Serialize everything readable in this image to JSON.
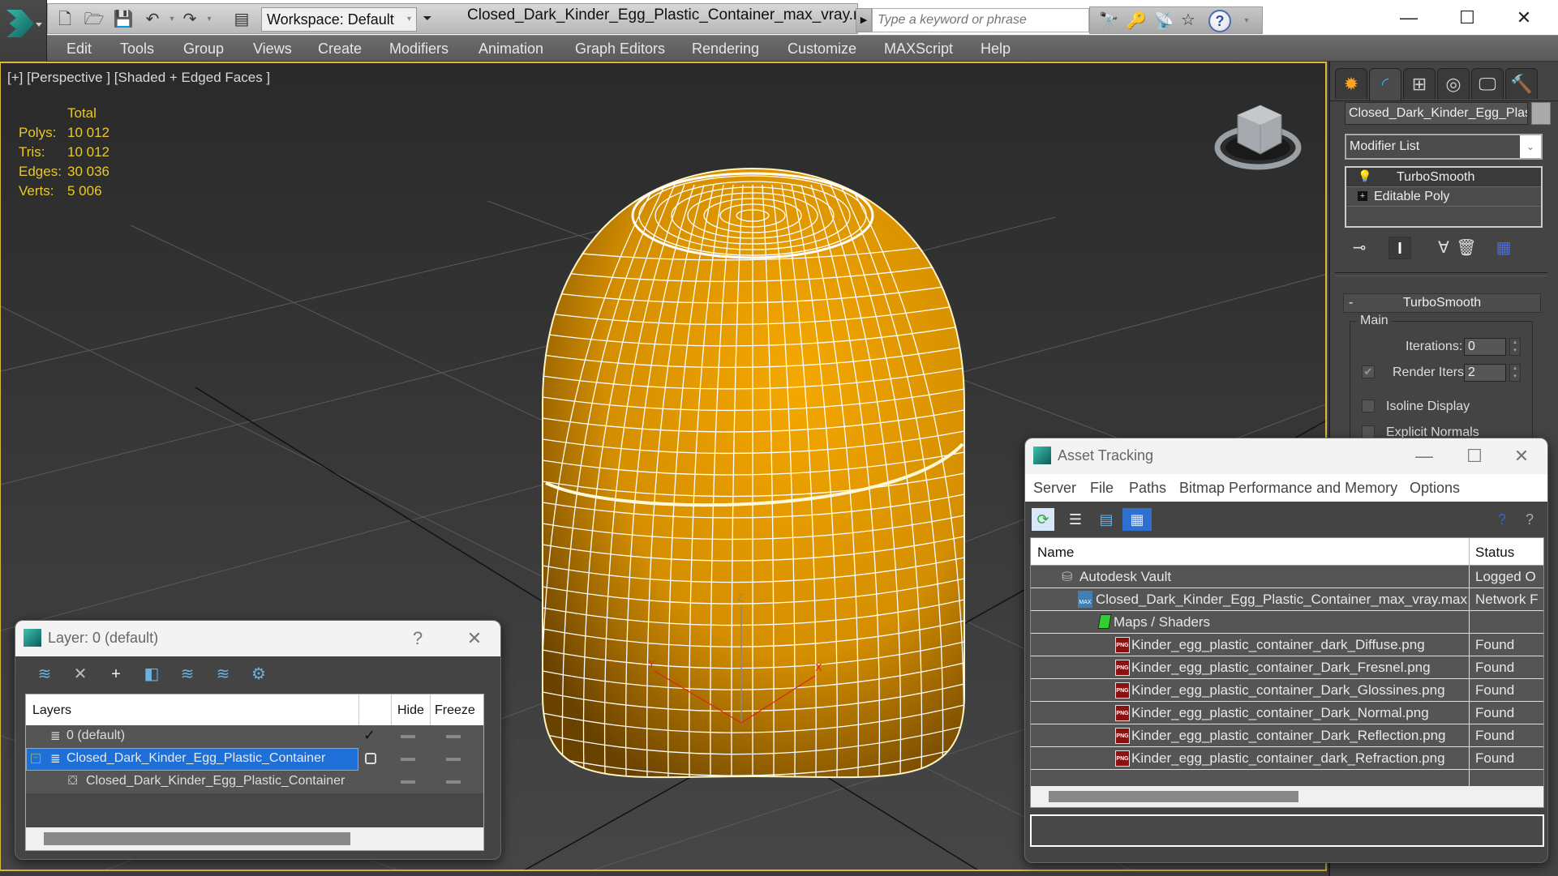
{
  "app": {
    "workspace_label": "Workspace: Default",
    "document_title": "Closed_Dark_Kinder_Egg_Plastic_Container_max_vray.max",
    "search_placeholder": "Type a keyword or phrase",
    "window_controls": {
      "minimize": "—",
      "maximize": "☐",
      "close": "✕"
    }
  },
  "menu": [
    "Edit",
    "Tools",
    "Group",
    "Views",
    "Create",
    "Modifiers",
    "Animation",
    "Graph Editors",
    "Rendering",
    "Customize",
    "MAXScript",
    "Help"
  ],
  "viewport": {
    "label": "[+] [Perspective ] [Shaded + Edged Faces ]",
    "stats": {
      "header": "Total",
      "rows": [
        {
          "label": "Polys:",
          "value": "10 012"
        },
        {
          "label": "Tris:",
          "value": "10 012"
        },
        {
          "label": "Edges:",
          "value": "30 036"
        },
        {
          "label": "Verts:",
          "value": "5 006"
        }
      ]
    },
    "model_color": "#f0a000",
    "wire_color": "#ffffff",
    "gizmo_axes": [
      "X",
      "Y",
      "Z"
    ]
  },
  "command_panel": {
    "tabs": [
      "create",
      "modify",
      "hierarchy",
      "motion",
      "display",
      "utilities"
    ],
    "active_tab": "modify",
    "object_name": "Closed_Dark_Kinder_Egg_Plastic_Container",
    "modifier_list_label": "Modifier List",
    "stack": [
      "TurboSmooth",
      "Editable Poly"
    ],
    "rollout_title": "TurboSmooth",
    "rollout_collapse": "-",
    "group_label": "Main",
    "iterations_label": "Iterations:",
    "iterations_value": "0",
    "render_iters_label": "Render Iters:",
    "render_iters_value": "2",
    "render_iters_checked": true,
    "isoline_label": "Isoline Display",
    "isoline_checked": false,
    "explicit_normals_label": "Explicit Normals",
    "explicit_normals_checked": false
  },
  "asset_tracking": {
    "title": "Asset Tracking",
    "menu": [
      "Server",
      "File",
      "Paths",
      "Bitmap Performance and Memory",
      "Options"
    ],
    "columns": [
      "Name",
      "Status"
    ],
    "rows": [
      {
        "name": "Autodesk Vault",
        "status": "Logged O",
        "level": 0,
        "icon": "vault-icon"
      },
      {
        "name": "Closed_Dark_Kinder_Egg_Plastic_Container_max_vray.max",
        "status": "Network F",
        "level": 1,
        "icon": "max-file-icon"
      },
      {
        "name": "Maps / Shaders",
        "status": "",
        "level": 2,
        "icon": "maps-icon"
      },
      {
        "name": "Kinder_egg_plastic_container_dark_Diffuse.png",
        "status": "Found",
        "level": 3,
        "icon": "png-icon"
      },
      {
        "name": "Kinder_egg_plastic_container_Dark_Fresnel.png",
        "status": "Found",
        "level": 3,
        "icon": "png-icon"
      },
      {
        "name": "Kinder_egg_plastic_container_Dark_Glossines.png",
        "status": "Found",
        "level": 3,
        "icon": "png-icon"
      },
      {
        "name": "Kinder_egg_plastic_container_Dark_Normal.png",
        "status": "Found",
        "level": 3,
        "icon": "png-icon"
      },
      {
        "name": "Kinder_egg_plastic_container_Dark_Reflection.png",
        "status": "Found",
        "level": 3,
        "icon": "png-icon"
      },
      {
        "name": "Kinder_egg_plastic_container_dark_Refraction.png",
        "status": "Found",
        "level": 3,
        "icon": "png-icon"
      }
    ],
    "png_badge": "PNG"
  },
  "layer_window": {
    "title": "Layer: 0 (default)",
    "help": "?",
    "columns": [
      "Layers",
      "Hide",
      "Freeze"
    ],
    "rows": [
      {
        "name": "0 (default)",
        "active": true,
        "selected": false,
        "level": 0
      },
      {
        "name": "Closed_Dark_Kinder_Egg_Plastic_Container",
        "active": false,
        "selected": true,
        "level": 0
      },
      {
        "name": "Closed_Dark_Kinder_Egg_Plastic_Container",
        "active": false,
        "selected": false,
        "level": 1
      }
    ],
    "selection_color": "#1f6fd8"
  }
}
